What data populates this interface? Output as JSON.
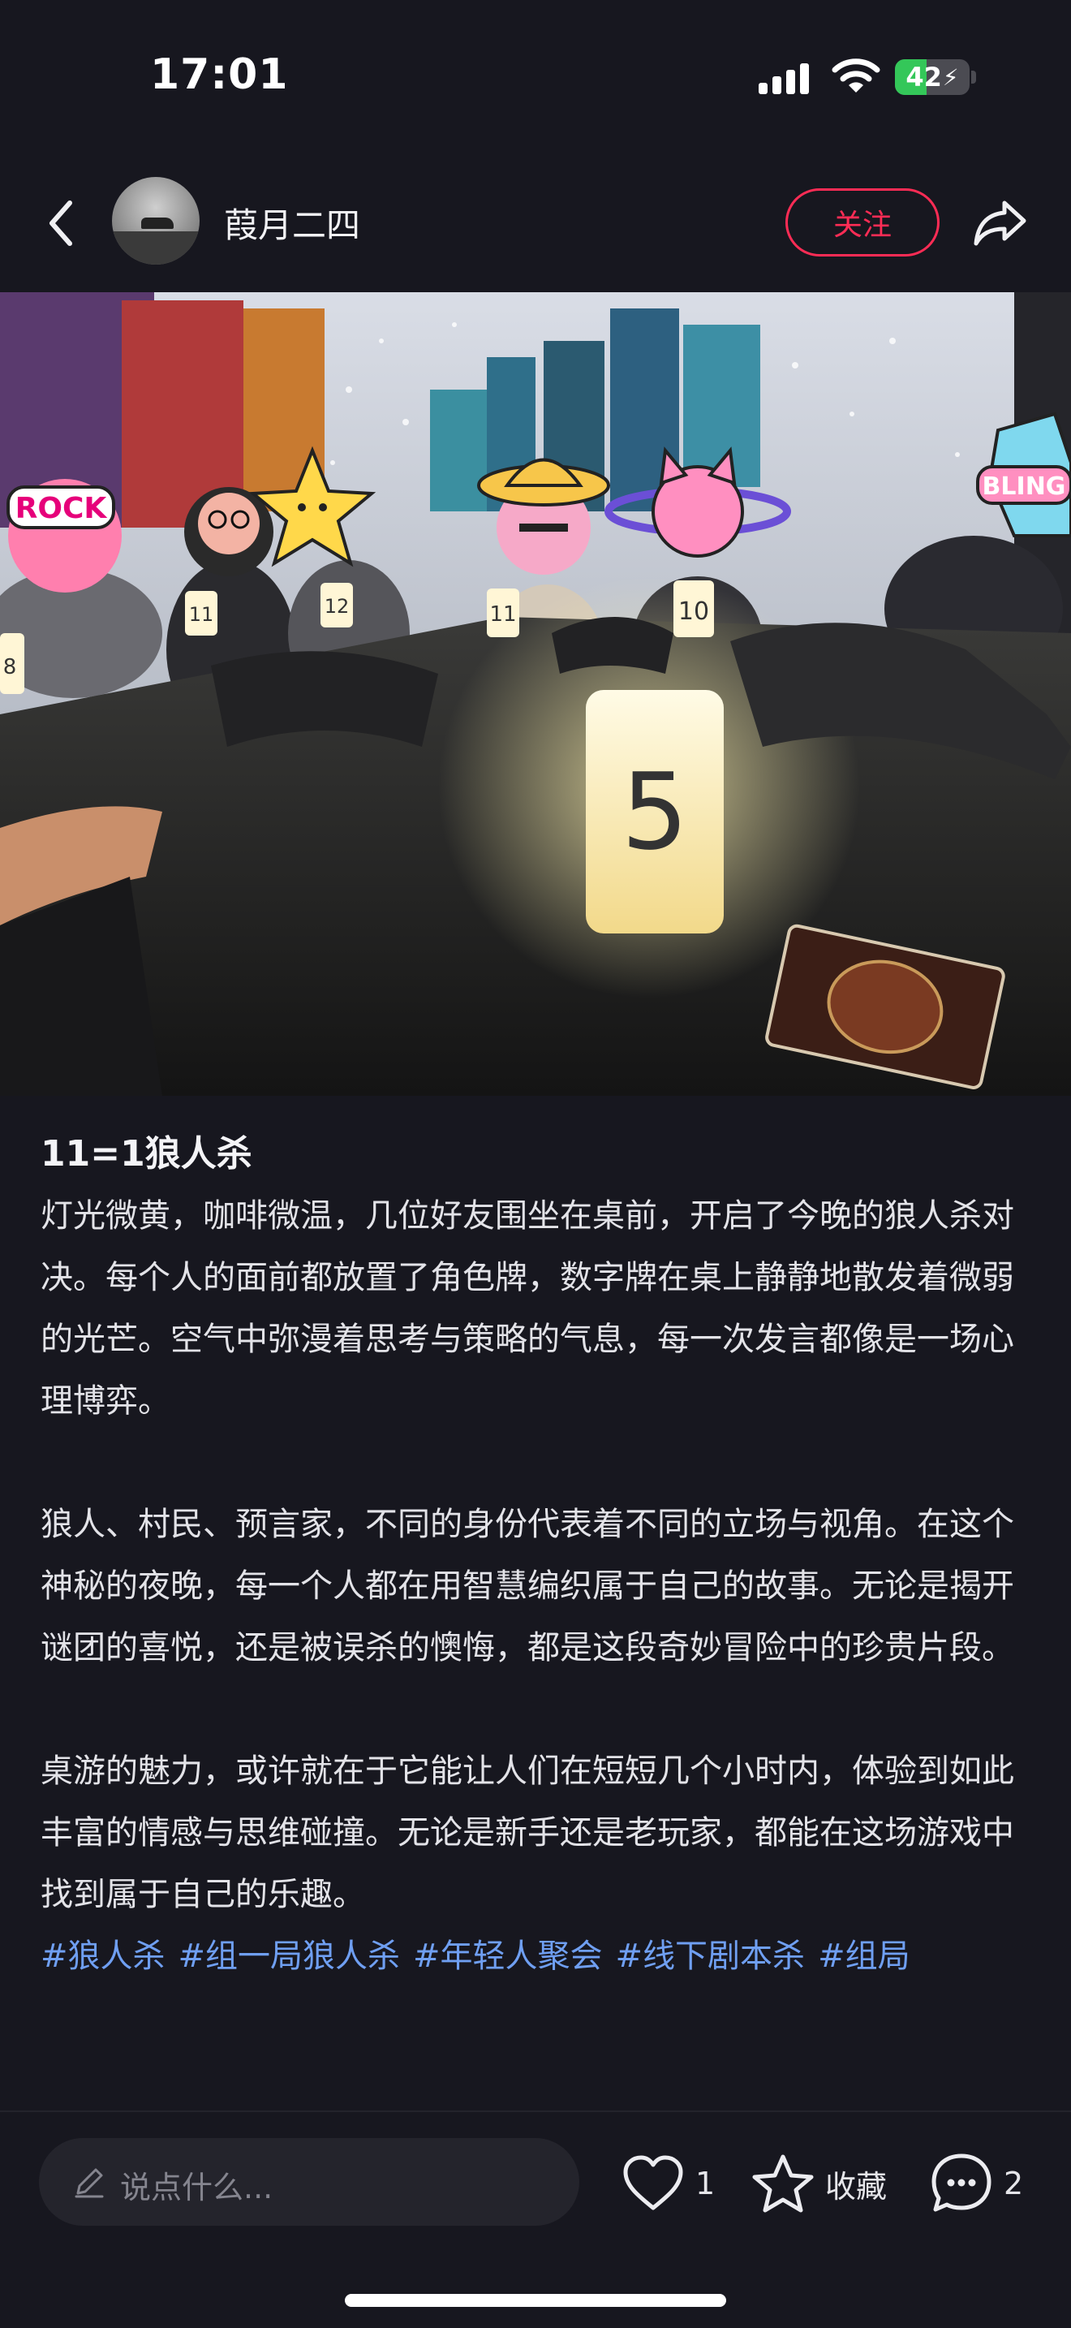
{
  "status_bar": {
    "time": "17:01",
    "battery_level": "42",
    "battery_fraction": 0.42
  },
  "header": {
    "username": "葭月二四",
    "follow_label": "关注"
  },
  "photo": {
    "stickers": [
      "ROCK",
      "BLING"
    ],
    "table_numbers": [
      "5",
      "10",
      "11",
      "12",
      "11",
      "8"
    ]
  },
  "post": {
    "title": "11=1狼人杀",
    "paragraphs": [
      "灯光微黄，咖啡微温，几位好友围坐在桌前，开启了今晚的狼人杀对决。每个人的面前都放置了角色牌，数字牌在桌上静静地散发着微弱的光芒。空气中弥漫着思考与策略的气息，每一次发言都像是一场心理博弈。",
      "狼人、村民、预言家，不同的身份代表着不同的立场与视角。在这个神秘的夜晚，每一个人都在用智慧编织属于自己的故事。无论是揭开谜团的喜悦，还是被误杀的懊悔，都是这段奇妙冒险中的珍贵片段。",
      "桌游的魅力，或许就在于它能让人们在短短几个小时内，体验到如此丰富的情感与思维碰撞。无论是新手还是老玩家，都能在这场游戏中找到属于自己的乐趣。"
    ],
    "tags": [
      "#狼人杀",
      "#组一局狼人杀",
      "#年轻人聚会",
      "#线下剧本杀",
      "#组局"
    ]
  },
  "bottom_bar": {
    "comment_placeholder": "说点什么...",
    "like_count": "1",
    "collect_label": "收藏",
    "comment_count": "2"
  },
  "colors": {
    "background": "#17171f",
    "accent": "#ff2c55",
    "tag": "#6f9ff2"
  }
}
